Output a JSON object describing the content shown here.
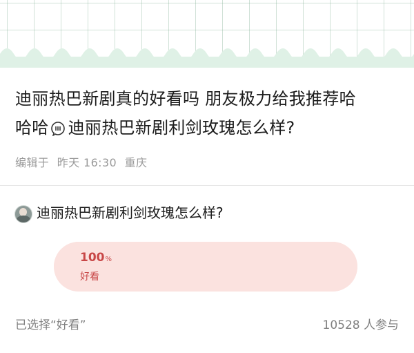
{
  "post": {
    "text_line1": "迪丽热巴新剧真的好看吗 朋友极力给我推荐哈",
    "text_line2_a": "哈哈",
    "text_line2_b": "迪丽热巴新剧利剑玫瑰怎么样?",
    "meta_edited": "编辑于",
    "meta_time": "昨天 16:30",
    "meta_location": "重庆",
    "inline_icon": "chat-bubble-icon"
  },
  "poll": {
    "question": "迪丽热巴新剧利剑玫瑰怎么样?",
    "options": [
      {
        "percent": "100",
        "percent_sign": "%",
        "label": "好看",
        "fraction": 1.0
      }
    ],
    "selected_text": "已选择“好看”",
    "participants_text": "10528 人参与"
  },
  "colors": {
    "banner": "#dff1e6",
    "option_bg": "#fbe5e3",
    "option_text": "#c84747"
  }
}
